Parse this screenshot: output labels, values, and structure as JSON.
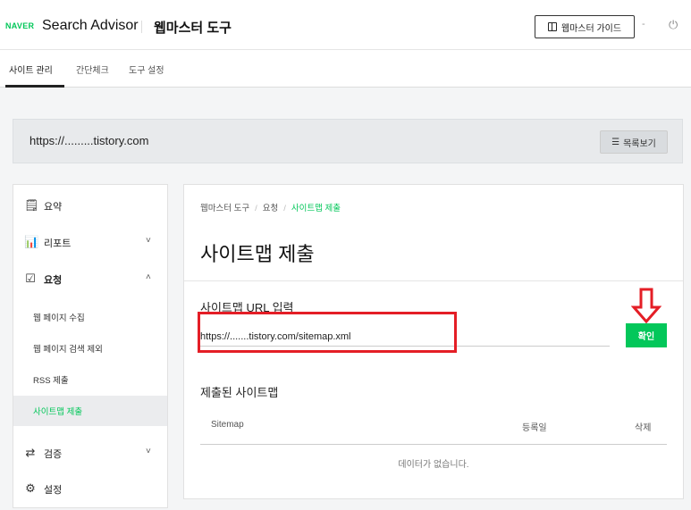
{
  "header": {
    "logo": "NAVER",
    "brand": "Search Advisor",
    "tool_title": "웹마스터 도구",
    "guide_button": "웹마스터 가이드",
    "dash": "-",
    "power_icon": "power-icon"
  },
  "tabs": [
    {
      "label": "사이트 관리",
      "active": true
    },
    {
      "label": "간단체크",
      "active": false
    },
    {
      "label": "도구 설정",
      "active": false
    }
  ],
  "site": {
    "url": "https://.........tistory.com",
    "list_button": "목록보기"
  },
  "sidebar": {
    "items": [
      {
        "label": "요약",
        "icon": "document-icon"
      },
      {
        "label": "리포트",
        "icon": "chart-icon",
        "chevron": "˅"
      },
      {
        "label": "요청",
        "icon": "check-clipboard-icon",
        "chevron": "˄"
      },
      {
        "label": "검증",
        "icon": "swap-icon",
        "chevron": "˅"
      },
      {
        "label": "설정",
        "icon": "gear-icon"
      }
    ],
    "sub_items": [
      {
        "label": "웹 페이지 수집",
        "active": false
      },
      {
        "label": "웹 페이지 검색 제외",
        "active": false
      },
      {
        "label": "RSS 제출",
        "active": false
      },
      {
        "label": "사이트맵 제출",
        "active": true
      }
    ]
  },
  "main": {
    "breadcrumb": [
      "웹마스터 도구",
      "요청",
      "사이트맵 제출"
    ],
    "title": "사이트맵 제출",
    "url_section_label": "사이트맵 URL 입력",
    "url_value": "https://.......tistory.com/sitemap.xml",
    "confirm_button": "확인",
    "submitted_title": "제출된 사이트맵",
    "table_headers": [
      "Sitemap",
      "등록일",
      "삭제"
    ],
    "empty_message": "데이터가 없습니다.",
    "colors": {
      "accent": "#03c75a",
      "highlight": "#e41e26"
    }
  }
}
